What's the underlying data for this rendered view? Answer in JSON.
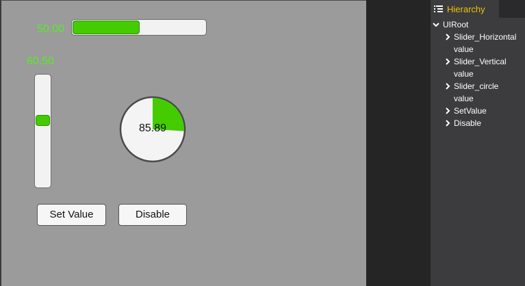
{
  "scene": {
    "horizontal_slider": {
      "value_text": "50.00",
      "value": 0.5
    },
    "vertical_slider": {
      "value_text": "60.50",
      "value": 0.605
    },
    "circle_slider": {
      "value_text": "85.89",
      "value": 0.2589
    },
    "buttons": {
      "set_value": "Set Value",
      "disable": "Disable"
    },
    "colors": {
      "accent_green": "#44cc00",
      "label_green": "#55ee22",
      "background": "#9b9b9b"
    }
  },
  "hierarchy": {
    "tab_label": "Hierarchy",
    "tab_icon": "hierarchy-list-icon",
    "tab_color": "#f0c200",
    "root": {
      "label": "UIRoot",
      "expanded": true
    },
    "items": [
      {
        "label": "Slider_Horizontal",
        "sublabel": "value"
      },
      {
        "label": "Slider_Vertical",
        "sublabel": "value"
      },
      {
        "label": "Slider_circle",
        "sublabel": "value"
      },
      {
        "label": "SetValue",
        "sublabel": ""
      },
      {
        "label": "Disable",
        "sublabel": ""
      }
    ]
  }
}
